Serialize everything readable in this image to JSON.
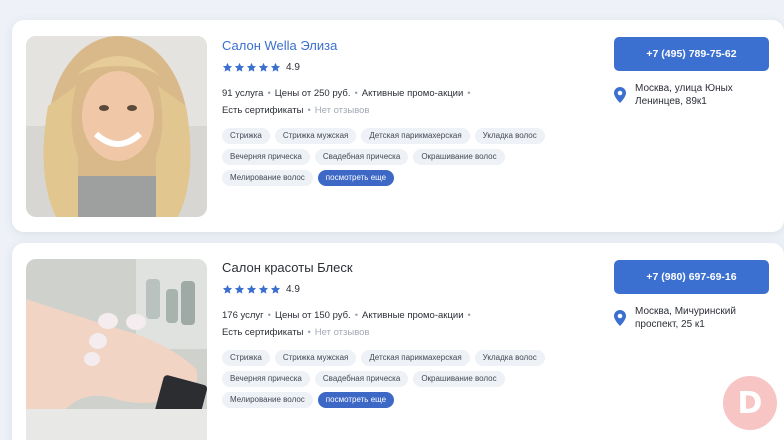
{
  "listings": [
    {
      "name": "Салон Wella Элиза",
      "rating": "4.9",
      "services_count": "91 услуга",
      "price": "Цены от 250 руб.",
      "promo": "Активные промо-акции",
      "certificates": "Есть сертификаты",
      "reviews": "Нет отзывов",
      "tags": [
        "Стрижка",
        "Стрижка мужская",
        "Детская парикмахерская",
        "Укладка волос",
        "Вечерняя прическа",
        "Свадебная прическа",
        "Окрашивание волос",
        "Мелирование волос"
      ],
      "more_label": "посмотреть еще",
      "phone": "+7 (495) 789-75-62",
      "address": "Москва, улица Юных Ленинцев, 89к1"
    },
    {
      "name": "Салон красоты Блеск",
      "rating": "4.9",
      "services_count": "176 услуг",
      "price": "Цены от 150 руб.",
      "promo": "Активные промо-акции",
      "certificates": "Есть сертификаты",
      "reviews": "Нет отзывов",
      "tags": [
        "Стрижка",
        "Стрижка мужская",
        "Детская парикмахерская",
        "Укладка волос",
        "Вечерняя прическа",
        "Свадебная прическа",
        "Окрашивание волос",
        "Мелирование волос"
      ],
      "more_label": "посмотреть еще",
      "phone": "+7 (980) 697-69-16",
      "address": "Москва, Мичуринский проспект, 25 к1"
    }
  ],
  "watermark": "D",
  "colors": {
    "accent": "#3b6fd0",
    "star": "#3b6fd0",
    "tag_bg": "#eef1f5",
    "watermark_bg": "#f6c5c4"
  },
  "icons": [
    "star-icon",
    "map-pin-icon"
  ]
}
